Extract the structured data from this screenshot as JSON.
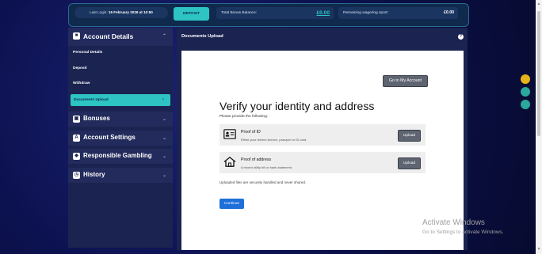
{
  "topbar": {
    "last_login_label": "Last Login:",
    "last_login_value": "16 February 2026 at 10:50",
    "deposit_label": "DEPOSIT",
    "bonus_balance_label": "Total Bonus Balance:",
    "bonus_balance_value": "£0.00",
    "wagering_label": "Remaining wagering sport:",
    "wagering_value": "£0.00"
  },
  "sidebar": {
    "account_details": {
      "title": "Account Details",
      "chevron": "⌃",
      "items": [
        {
          "label": "Personal Details"
        },
        {
          "label": "Deposit"
        },
        {
          "label": "Withdraw"
        },
        {
          "label": "Documents Upload",
          "active": true
        }
      ]
    },
    "sections": [
      {
        "title": "Bonuses",
        "icon": "bonus-icon"
      },
      {
        "title": "Account Settings",
        "icon": "settings-icon"
      },
      {
        "title": "Responsible Gambling",
        "icon": "shield-icon"
      },
      {
        "title": "History",
        "icon": "history-icon"
      }
    ]
  },
  "main": {
    "header": "Documents Upload",
    "my_account_button": "Go to My Account",
    "title": "Verify your identity and address",
    "subtitle": "Please provide the following:",
    "rows": [
      {
        "heading": "Proof of ID",
        "desc": "Either your drivers licence, passport or ID card.",
        "button": "Upload",
        "icon": "id-card-icon"
      },
      {
        "heading": "Proof of address",
        "desc": "A recent utility bill or bank statement.",
        "button": "Upload",
        "icon": "home-icon"
      }
    ],
    "note": "Uploaded files are securely handled and never shared.",
    "continue_button": "Continue"
  },
  "watermark": {
    "line1": "Activate Windows",
    "line2": "Go to Settings to activate Windows."
  },
  "colors": {
    "accent": "#2ec4c4",
    "panel": "#1b2350",
    "continue": "#1e6fd9",
    "float_yellow": "#e6b21a",
    "float_teal": "#2aa89a"
  }
}
